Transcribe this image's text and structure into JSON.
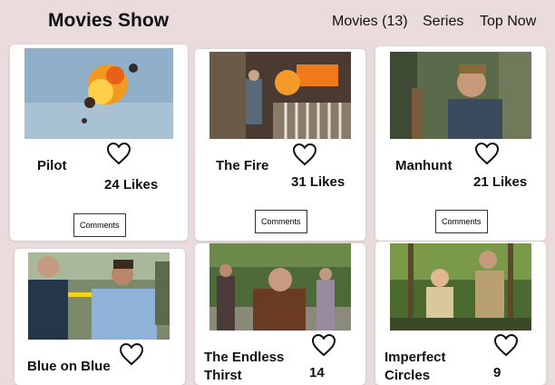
{
  "header": {
    "title": "Movies Show",
    "nav": [
      "Movies (13)",
      "Series",
      "Top Now"
    ]
  },
  "episodes": [
    {
      "title": "Pilot",
      "likes": "24 Likes",
      "comments_label": "Comments",
      "heart_icon": "heart-outline-icon",
      "thumbnail": "explosion-in-sky"
    },
    {
      "title": "The Fire",
      "likes": "31 Likes",
      "comments_label": "Comments",
      "heart_icon": "heart-outline-icon",
      "thumbnail": "porch-on-fire"
    },
    {
      "title": "Manhunt",
      "likes": "21 Likes",
      "comments_label": "Comments",
      "heart_icon": "heart-outline-icon",
      "thumbnail": "man-in-forest"
    },
    {
      "title": "Blue on Blue",
      "likes": "",
      "comments_label": "",
      "heart_icon": "heart-outline-icon",
      "thumbnail": "police-officers"
    },
    {
      "title": "The Endless Thirst",
      "likes": "14",
      "comments_label": "",
      "heart_icon": "heart-outline-icon",
      "thumbnail": "crowd-outdoors"
    },
    {
      "title": "Imperfect Circles",
      "likes": "9",
      "comments_label": "",
      "heart_icon": "heart-outline-icon",
      "thumbnail": "kids-in-forest"
    }
  ]
}
